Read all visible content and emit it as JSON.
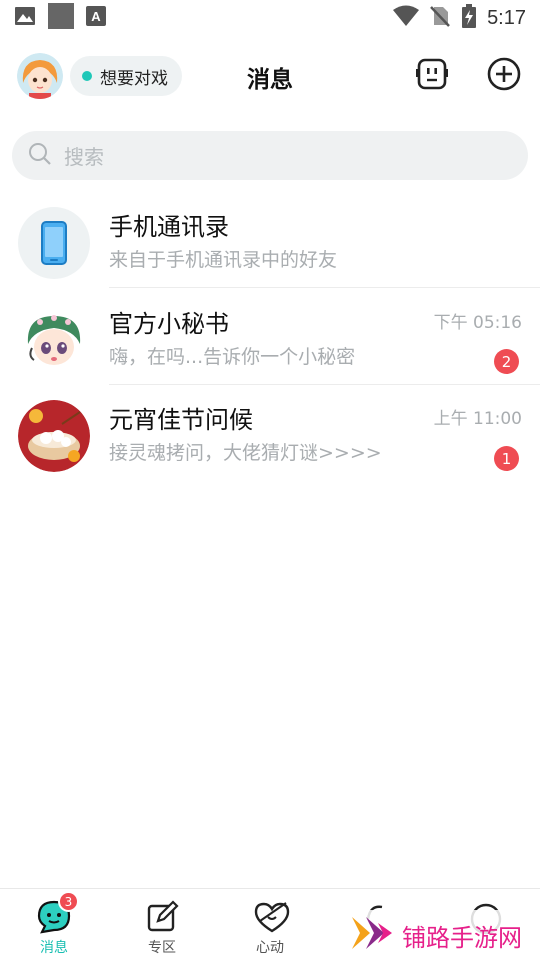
{
  "status_bar": {
    "time": "5:17",
    "left_icons": [
      "image-icon",
      "square-icon",
      "font-app-icon"
    ],
    "right_icons": [
      "wifi-icon",
      "no-sim-icon",
      "battery-charging-icon"
    ]
  },
  "header": {
    "title": "消息",
    "status_label": "想要对戏",
    "status_color": "#1fc8b8",
    "right_icons": [
      "robot-face-icon",
      "add-circle-icon"
    ]
  },
  "search": {
    "placeholder": "搜索"
  },
  "conversations": [
    {
      "title": "手机通讯录",
      "subtitle": "来自于手机通讯录中的好友",
      "time": "",
      "badge": "",
      "avatar_icon": "phone-icon"
    },
    {
      "title": "官方小秘书",
      "subtitle": "嗨，在吗...告诉你一个小秘密",
      "time": "下午 05:16",
      "badge": "2",
      "avatar_icon": "girl-avatar"
    },
    {
      "title": "元宵佳节问候",
      "subtitle": "接灵魂拷问，大佬猜灯谜>>>>",
      "time": "上午 11:00",
      "badge": "1",
      "avatar_icon": "festival-dumplings-avatar"
    }
  ],
  "bottom_nav": {
    "items": [
      {
        "label": "消息",
        "icon": "message-bubble-icon",
        "badge": "3",
        "active": true
      },
      {
        "label": "专区",
        "icon": "edit-square-icon",
        "badge": "",
        "active": false
      },
      {
        "label": "心动",
        "icon": "heart-arrow-icon",
        "badge": "",
        "active": false
      },
      {
        "label": "",
        "icon": "hidden-icon",
        "badge": "",
        "active": false
      },
      {
        "label": "",
        "icon": "smile-icon",
        "badge": "",
        "active": false
      }
    ]
  },
  "watermark": {
    "text": "铺路手游网"
  },
  "colors": {
    "accent": "#19bfb2",
    "badge": "#ef4c53",
    "watermark": "#e6208a"
  }
}
